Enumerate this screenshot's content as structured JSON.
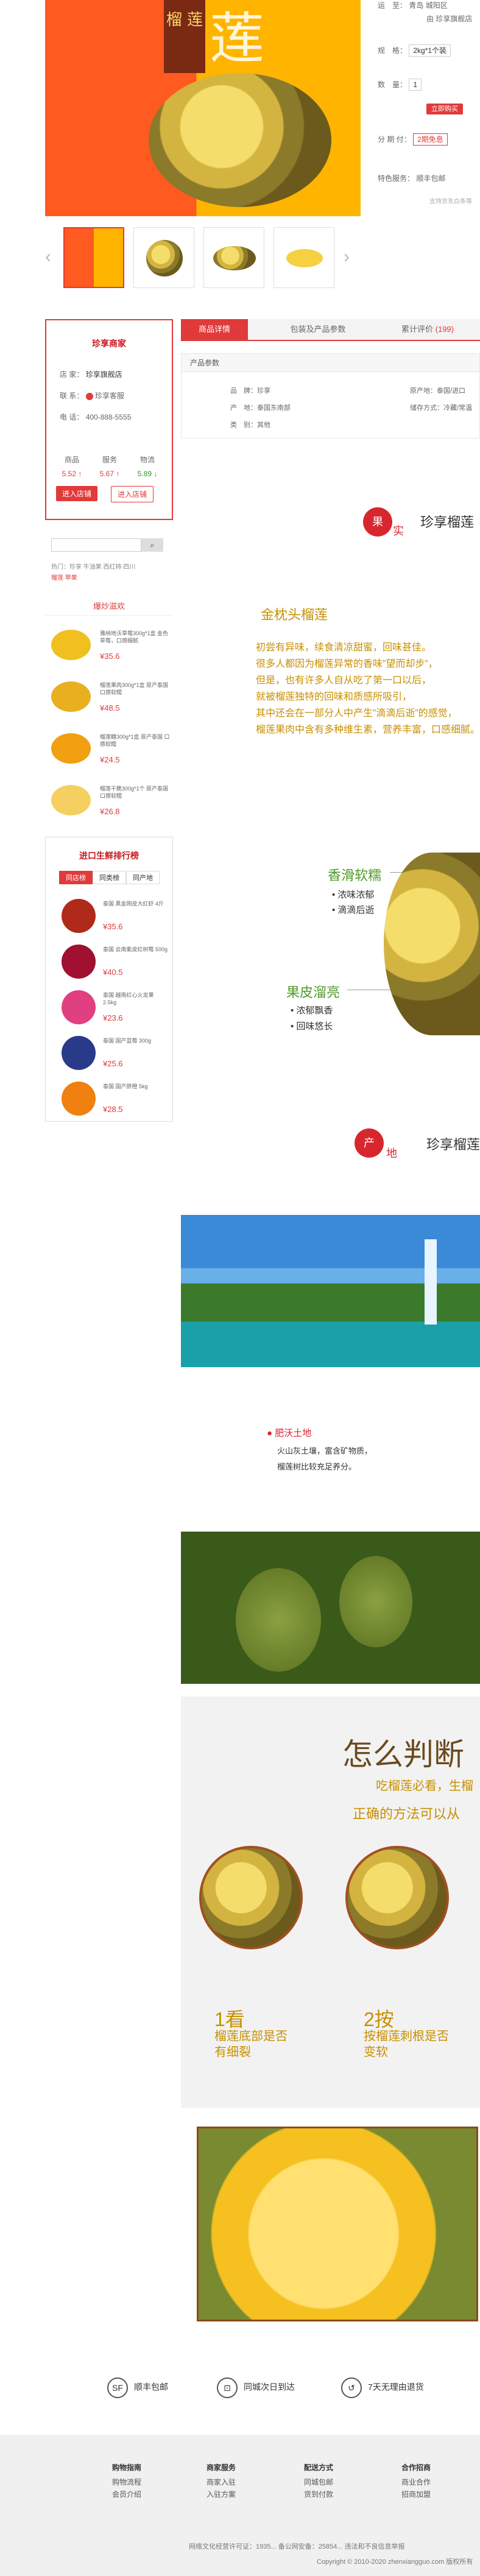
{
  "hero": {
    "tag": "榴\n莲",
    "big_char": "莲"
  },
  "product_info": {
    "ship_label": "运　至：",
    "ship_value": "青岛 城阳区",
    "ship_from": "由 珍享旗舰店",
    "spec_label": "规　格：",
    "spec_value": "2kg*1个装",
    "qty_label": "数　量：",
    "qty_value": "1",
    "buy_button": "立即购买",
    "installment_label": "分 期 付：",
    "installment_value": "2期免息",
    "service_label": "特色服务：",
    "service_value": "顺丰包邮",
    "note": "支持京东白条等"
  },
  "shop": {
    "title": "珍享商家",
    "store_label": "店 家：",
    "store_name": "珍享旗舰店",
    "contact_label": "联 系：",
    "contact_value": "珍享客服",
    "phone_label": "电 话：",
    "phone_value": "400-888-5555",
    "scores": [
      {
        "label": "商品",
        "value": "5.52 ↑"
      },
      {
        "label": "服务",
        "value": "5.67 ↑"
      },
      {
        "label": "物流",
        "value": "5.89 ↓"
      }
    ],
    "enter_store": "进入店铺",
    "enter_store2": "进入店铺"
  },
  "search": {
    "placeholder": "",
    "hot_label": "热门：",
    "hot_terms": "珍享 牛油果 西红柿 四川",
    "hot_terms2": "榴莲 苹果"
  },
  "hot_list": {
    "title": "爆炒滋欢",
    "items": [
      {
        "title": "雅纳地沃草莓300g*1盒 金色草莓，口感细腻",
        "price": "¥35.6"
      },
      {
        "title": "榴莲果肉300g*1盒 原产泰国 口感软糯",
        "price": "¥48.5"
      },
      {
        "title": "榴莲糖300g*1盒 原产泰国 口感软糯",
        "price": "¥24.5"
      },
      {
        "title": "榴莲干脆300g*1个 原产泰国 口感软糯",
        "price": "¥26.8"
      }
    ]
  },
  "rank": {
    "title": "进口生鲜排行榜",
    "tabs": [
      "同店榜",
      "同类榜",
      "同产地"
    ],
    "items": [
      {
        "title": "泰国 黑金刚皮大红虾 4斤",
        "price": "¥35.6"
      },
      {
        "title": "泰国 云南紫皮红树莓 500g",
        "price": "¥40.5"
      },
      {
        "title": "泰国 越南红心火龙果 2.5kg",
        "price": "¥23.6"
      },
      {
        "title": "泰国 国产蓝莓 300g",
        "price": "¥25.6"
      },
      {
        "title": "泰国 国产脐橙 5kg",
        "price": "¥28.5"
      }
    ]
  },
  "detail_tabs": {
    "tabs": [
      "商品详情",
      "包装及产品参数",
      "累计评价"
    ],
    "review_count": "(199)",
    "params_title": "产品参数",
    "params": [
      {
        "k": "品　牌：珍享"
      },
      {
        "k": "原产地：泰国/进口"
      },
      {
        "k": "产　地：泰国东南部"
      },
      {
        "k": "储存方式：冷藏/常温"
      },
      {
        "k": "类　别：其他"
      }
    ]
  },
  "section1": {
    "circle": "果",
    "char2": "实",
    "title": "珍享榴莲"
  },
  "pitch": {
    "heading": "金枕头榴莲",
    "lines": [
      "初尝有异味，续食清凉甜蜜，回味甚佳。",
      "很多人都因为榴莲异常的香味”望而却步”，",
      "但是，也有许多人自从吃了第一口以后，",
      "就被榴莲独特的回味和质感所吸引，",
      "其中还会在一部分人中产生”滴滴后逝”的感觉，",
      "榴莲果肉中含有多种维生素，营养丰富，口感细腻。"
    ]
  },
  "features": {
    "f1": "香滑软糯",
    "f1a": "浓味浓郁",
    "f1b": "滴滴后逝",
    "f2": "果皮溜亮",
    "f2a": "浓郁飘香",
    "f2b": "回味悠长"
  },
  "section2": {
    "circle": "产",
    "char2": "地",
    "title": "珍享榴莲"
  },
  "origin": {
    "title": "肥沃土地",
    "l1": "火山灰土壤，富含矿物质，",
    "l2": "榴莲树比较充足养分。"
  },
  "judge": {
    "t1": "怎么判断",
    "t2": "吃榴莲必看，生榴",
    "t3": "正确的方法可以从",
    "s1_num": "1看",
    "s1_txt1": "榴莲底部是否",
    "s1_txt2": "有细裂",
    "s2_num": "2按",
    "s2_txt1": "按榴莲刺根是否",
    "s2_txt2": "变软"
  },
  "services": [
    {
      "icon": "SF",
      "label": "顺丰包邮"
    },
    {
      "icon": "⊡",
      "label": "同城次日到达"
    },
    {
      "icon": "↺",
      "label": "7天无理由退货"
    }
  ],
  "footer": {
    "cols": [
      {
        "h": "购物指南",
        "a": "购物流程",
        "b": "会员介绍"
      },
      {
        "h": "商家服务",
        "a": "商家入驻",
        "b": "入驻方案"
      },
      {
        "h": "配送方式",
        "a": "同城包邮",
        "b": "货到付款"
      },
      {
        "h": "合作招商",
        "a": "商业合作",
        "b": "招商加盟"
      }
    ],
    "legal": "网络文化经营许可证：1935...  备公网安备：25854...  违法和不良信息举报",
    "copy": "Copyright © 2010-2020 zhenxiangguo.com 版权所有"
  },
  "colors": {
    "accent": "#e03a3a",
    "gold": "#c89000",
    "green": "#4f9a28"
  }
}
